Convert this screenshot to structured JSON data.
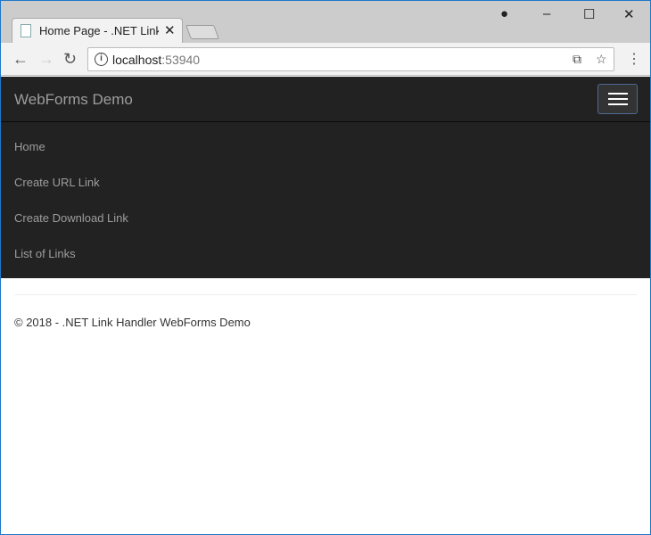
{
  "browser": {
    "tab_title": "Home Page - .NET Link Handler WebForms Demo",
    "url_host": "localhost",
    "url_port": ":53940",
    "info_glyph": "i"
  },
  "site": {
    "brand": "WebForms Demo",
    "nav": [
      {
        "label": "Home"
      },
      {
        "label": "Create URL Link"
      },
      {
        "label": "Create Download Link"
      },
      {
        "label": "List of Links"
      }
    ],
    "footer": "© 2018 - .NET Link Handler WebForms Demo"
  }
}
